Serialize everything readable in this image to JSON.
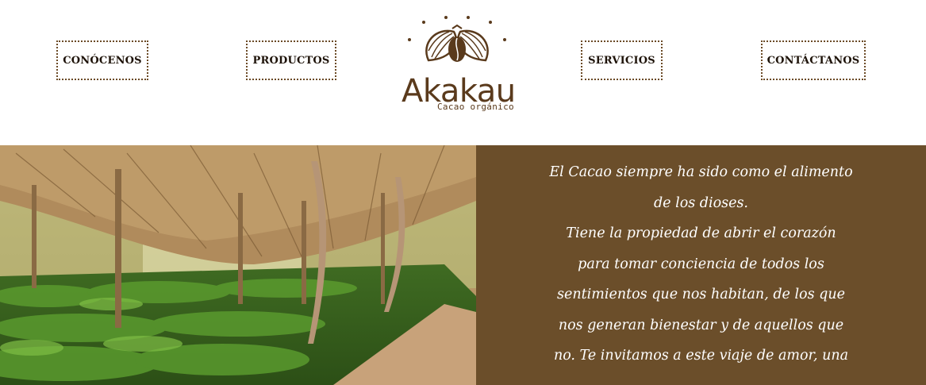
{
  "nav": {
    "items": [
      {
        "label": "CONÓCENOS"
      },
      {
        "label": "PRODUCTOS"
      },
      {
        "label": "SERVICIOS"
      },
      {
        "label": "CONTÁCTANOS"
      }
    ]
  },
  "logo": {
    "name": "Akakau",
    "tagline": "Cacao orgánico",
    "icon": "cacao-pod-icon"
  },
  "hero": {
    "image": "cacao-nursery-photo",
    "quote_lines": [
      "El Cacao siempre ha sido como el alimento",
      "de los dioses.",
      "Tiene la propiedad de abrir el corazón",
      "para tomar conciencia de todos los",
      "sentimientos que nos habitan, de los que",
      "nos generan bienestar y de aquellos que",
      "no. Te invitamos a este viaje de amor, una"
    ]
  },
  "colors": {
    "brand_brown": "#6b4e2a",
    "logo_brown": "#5a3a1c",
    "nav_text": "#1d1208",
    "quote_text": "#ffffff"
  }
}
